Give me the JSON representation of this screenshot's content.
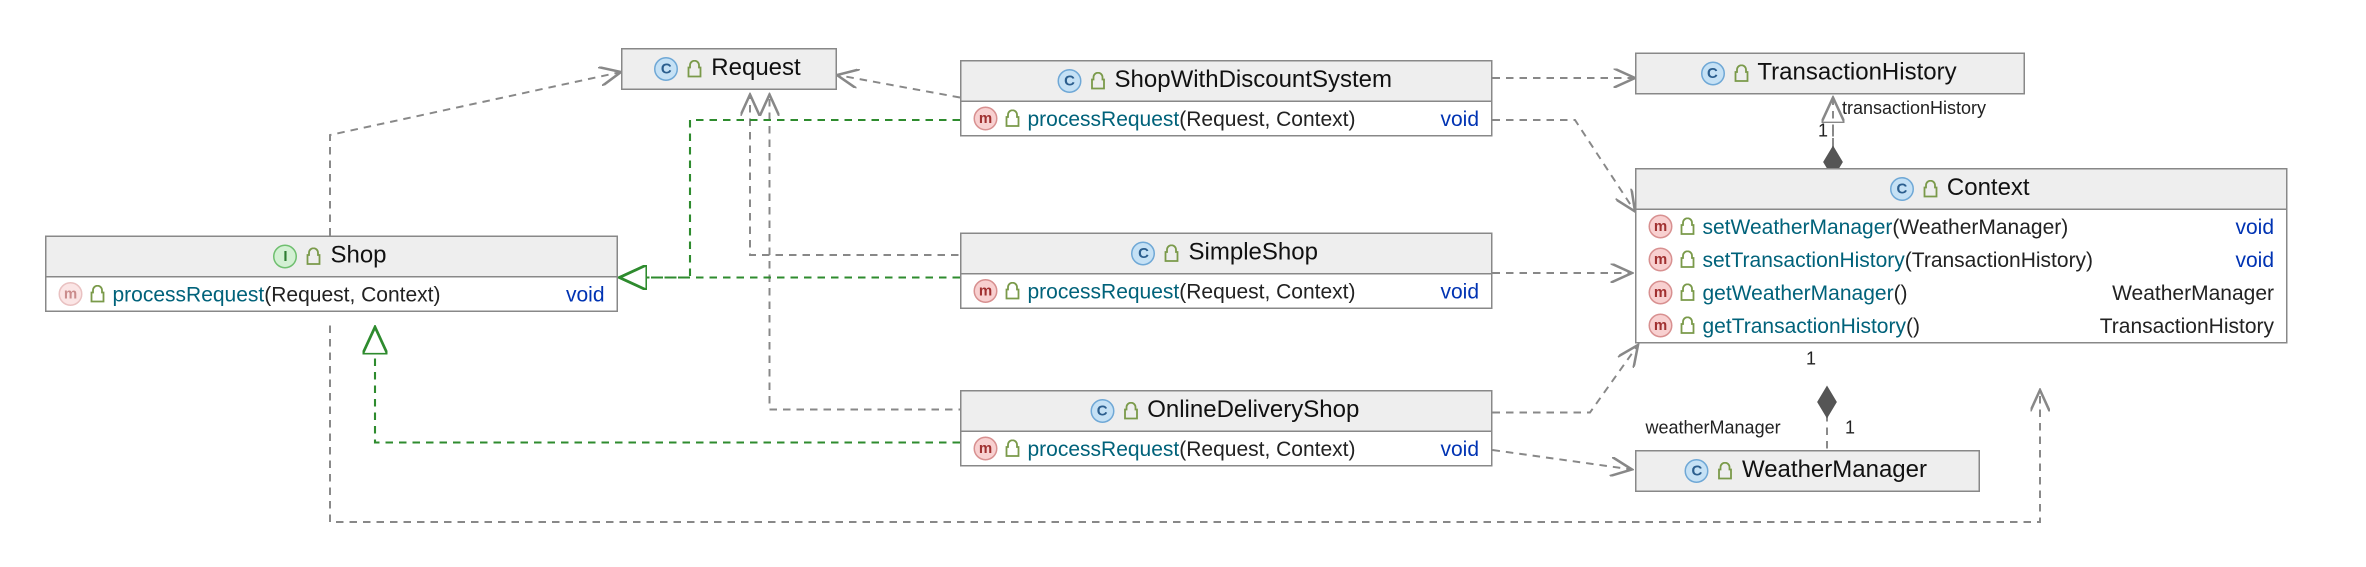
{
  "diagram": {
    "type": "UML class diagram",
    "classes": {
      "request": {
        "name": "Request",
        "kind": "class",
        "members": []
      },
      "shop": {
        "name": "Shop",
        "kind": "interface",
        "members": [
          {
            "kind": "method",
            "faded": true,
            "name": "processRequest",
            "paramsText": "(Request, Context)",
            "returns": "void",
            "returnsKind": "void"
          }
        ]
      },
      "shopWithDiscount": {
        "name": "ShopWithDiscountSystem",
        "kind": "class",
        "members": [
          {
            "kind": "method",
            "name": "processRequest",
            "paramsText": "(Request, Context)",
            "returns": "void",
            "returnsKind": "void"
          }
        ]
      },
      "simpleShop": {
        "name": "SimpleShop",
        "kind": "class",
        "members": [
          {
            "kind": "method",
            "name": "processRequest",
            "paramsText": "(Request, Context)",
            "returns": "void",
            "returnsKind": "void"
          }
        ]
      },
      "onlineDeliveryShop": {
        "name": "OnlineDeliveryShop",
        "kind": "class",
        "members": [
          {
            "kind": "method",
            "name": "processRequest",
            "paramsText": "(Request, Context)",
            "returns": "void",
            "returnsKind": "void"
          }
        ]
      },
      "transactionHistory": {
        "name": "TransactionHistory",
        "kind": "class",
        "members": []
      },
      "weatherManager": {
        "name": "WeatherManager",
        "kind": "class",
        "members": []
      },
      "context": {
        "name": "Context",
        "kind": "class",
        "members": [
          {
            "kind": "method",
            "name": "setWeatherManager",
            "paramsText": "(WeatherManager)",
            "returns": "void",
            "returnsKind": "void"
          },
          {
            "kind": "method",
            "name": "setTransactionHistory",
            "paramsText": "(TransactionHistory)",
            "returns": "void",
            "returnsKind": "void"
          },
          {
            "kind": "method",
            "name": "getWeatherManager",
            "paramsText": "()",
            "returns": "WeatherManager",
            "returnsKind": "type"
          },
          {
            "kind": "method",
            "name": "getTransactionHistory",
            "paramsText": "()",
            "returns": "TransactionHistory",
            "returnsKind": "type"
          }
        ]
      }
    },
    "associations": {
      "transactionHistoryRole": {
        "name": "transactionHistory",
        "multiplicity": "1"
      },
      "weatherManagerRole": {
        "name": "weatherManager",
        "multiplicity": "1"
      },
      "contextOne": {
        "multiplicity": "1"
      }
    }
  },
  "chart_data": {
    "type": "class-diagram",
    "nodes": [
      {
        "id": "Request",
        "stereotype": "class"
      },
      {
        "id": "Shop",
        "stereotype": "interface",
        "methods": [
          "processRequest(Request, Context): void"
        ]
      },
      {
        "id": "ShopWithDiscountSystem",
        "stereotype": "class",
        "methods": [
          "processRequest(Request, Context): void"
        ]
      },
      {
        "id": "SimpleShop",
        "stereotype": "class",
        "methods": [
          "processRequest(Request, Context): void"
        ]
      },
      {
        "id": "OnlineDeliveryShop",
        "stereotype": "class",
        "methods": [
          "processRequest(Request, Context): void"
        ]
      },
      {
        "id": "TransactionHistory",
        "stereotype": "class"
      },
      {
        "id": "WeatherManager",
        "stereotype": "class"
      },
      {
        "id": "Context",
        "stereotype": "class",
        "methods": [
          "setWeatherManager(WeatherManager): void",
          "setTransactionHistory(TransactionHistory): void",
          "getWeatherManager(): WeatherManager",
          "getTransactionHistory(): TransactionHistory"
        ]
      }
    ],
    "edges": [
      {
        "from": "ShopWithDiscountSystem",
        "to": "Shop",
        "type": "realization"
      },
      {
        "from": "SimpleShop",
        "to": "Shop",
        "type": "realization"
      },
      {
        "from": "OnlineDeliveryShop",
        "to": "Shop",
        "type": "realization"
      },
      {
        "from": "ShopWithDiscountSystem",
        "to": "Request",
        "type": "dependency"
      },
      {
        "from": "SimpleShop",
        "to": "Request",
        "type": "dependency"
      },
      {
        "from": "OnlineDeliveryShop",
        "to": "Request",
        "type": "dependency"
      },
      {
        "from": "Shop",
        "to": "Request",
        "type": "dependency"
      },
      {
        "from": "Shop",
        "to": "Context",
        "type": "dependency"
      },
      {
        "from": "ShopWithDiscountSystem",
        "to": "TransactionHistory",
        "type": "dependency"
      },
      {
        "from": "ShopWithDiscountSystem",
        "to": "Context",
        "type": "dependency"
      },
      {
        "from": "SimpleShop",
        "to": "Context",
        "type": "dependency"
      },
      {
        "from": "OnlineDeliveryShop",
        "to": "Context",
        "type": "dependency"
      },
      {
        "from": "OnlineDeliveryShop",
        "to": "WeatherManager",
        "type": "dependency"
      },
      {
        "from": "Context",
        "to": "TransactionHistory",
        "type": "aggregation-diamond-at-Context",
        "role": "transactionHistory",
        "multiplicity": "1"
      },
      {
        "from": "Context",
        "to": "WeatherManager",
        "type": "aggregation-diamond-at-Context",
        "role": "weatherManager",
        "multiplicity": "1"
      }
    ]
  }
}
